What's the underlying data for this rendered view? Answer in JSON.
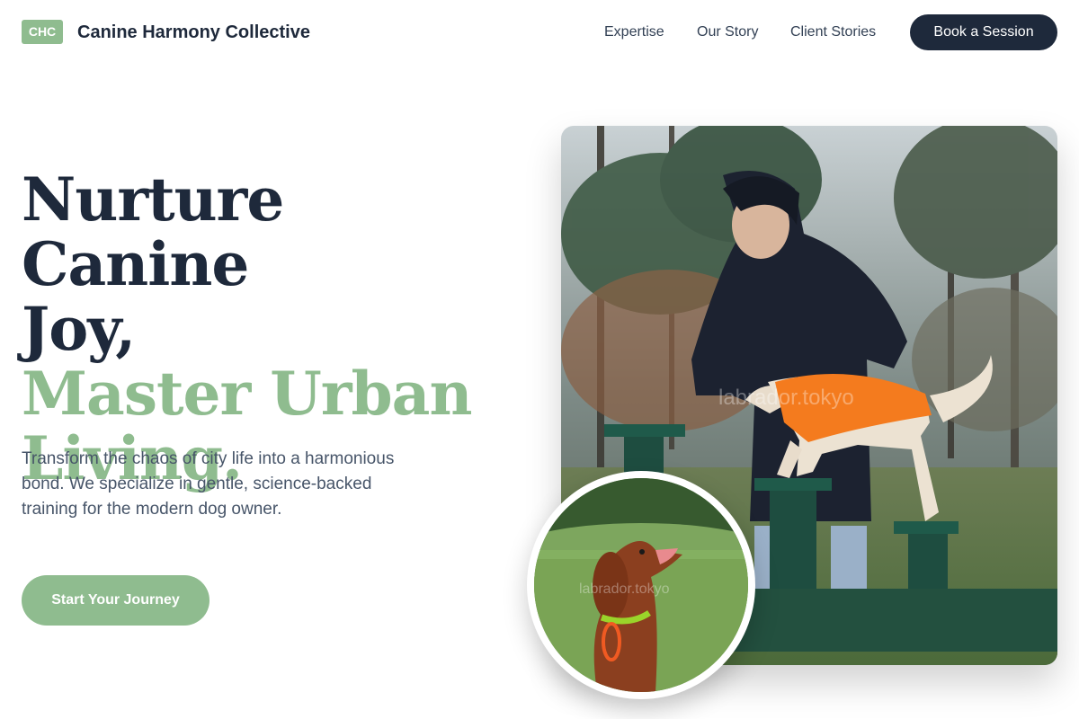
{
  "header": {
    "logo_text": "CHC",
    "brand_name": "Canine Harmony Collective",
    "nav": [
      "Expertise",
      "Our Story",
      "Client Stories"
    ],
    "cta_label": "Book a Session"
  },
  "hero": {
    "headline_line1": "Nurture Canine",
    "headline_line2": "Joy,",
    "headline_line3": "Master Urban",
    "headline_line4": "Living.",
    "subtext": "Transform the chaos of city life into a harmonious bond. We specialize in gentle, science-backed training for the modern dog owner.",
    "cta_label": "Start Your Journey"
  },
  "images": {
    "main_watermark": "labrador.tokyo",
    "circle_watermark": "labrador.tokyo"
  },
  "colors": {
    "primary_dark": "#1e293b",
    "accent_green": "#8fbc8f",
    "body_text": "#475569"
  }
}
